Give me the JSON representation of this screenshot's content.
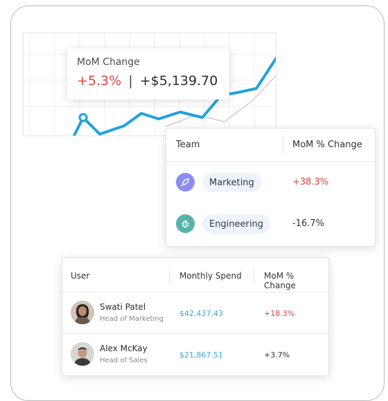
{
  "tooltip": {
    "title": "MoM Change",
    "percent": "+5.3%",
    "separator": "|",
    "amount": "+$5,139.70"
  },
  "chart": {
    "line_color": "#1ea2e0",
    "secondary_color": "#d0d0d0"
  },
  "team_table": {
    "headers": {
      "team": "Team",
      "change": "MoM % Change"
    },
    "rows": [
      {
        "team": "Marketing",
        "change": "+38.3%",
        "icon": "rocket-icon",
        "icon_color": "#8b8ef0",
        "change_color": "#e0453c"
      },
      {
        "team": "Engineering",
        "change": "-16.7%",
        "icon": "bug-icon",
        "icon_color": "#56b3a7",
        "change_color": "#333333"
      }
    ]
  },
  "user_table": {
    "headers": {
      "user": "User",
      "spend": "Monthly Spend",
      "change": "MoM % Change"
    },
    "rows": [
      {
        "name": "Swati Patel",
        "title": "Head of Marketing",
        "spend": "$42,437.43",
        "change": "+18.3%",
        "change_color": "#e0453c"
      },
      {
        "name": "Alex McKay",
        "title": "Head of Sales",
        "spend": "$21,867.51",
        "change": "+3.7%",
        "change_color": "#333333"
      }
    ]
  }
}
